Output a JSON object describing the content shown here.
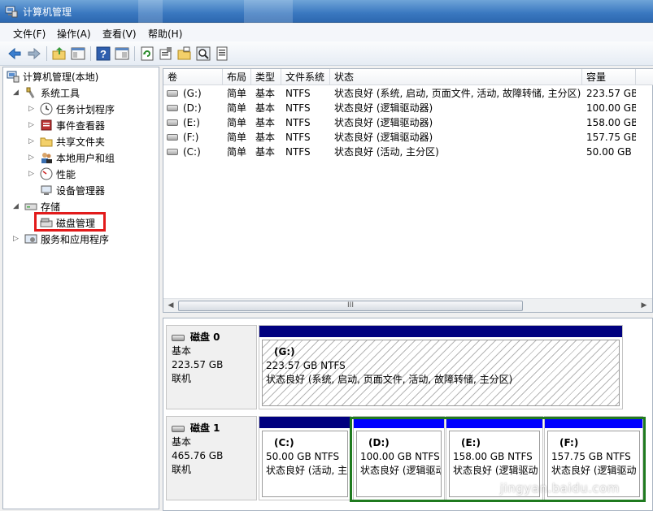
{
  "window": {
    "title": "计算机管理"
  },
  "menu": [
    "文件(F)",
    "操作(A)",
    "查看(V)",
    "帮助(H)"
  ],
  "toolbar": [
    "back-icon",
    "forward-icon",
    "up-folder-icon",
    "show-tree-icon",
    "help-icon",
    "console-icon",
    "refresh-icon",
    "properties-icon",
    "open-folder-icon",
    "search-icon",
    "export-icon"
  ],
  "tree": {
    "root": "计算机管理(本地)",
    "system_tools": "系统工具",
    "items": [
      "任务计划程序",
      "事件查看器",
      "共享文件夹",
      "本地用户和组",
      "性能",
      "设备管理器"
    ],
    "storage": "存储",
    "disk_mgmt": "磁盘管理",
    "services": "服务和应用程序"
  },
  "table": {
    "headers": [
      "卷",
      "布局",
      "类型",
      "文件系统",
      "状态",
      "容量"
    ],
    "rows": [
      {
        "vol": "(G:)",
        "layout": "简单",
        "type": "基本",
        "fs": "NTFS",
        "status": "状态良好 (系统, 启动, 页面文件, 活动, 故障转储, 主分区)",
        "cap": "223.57 GB"
      },
      {
        "vol": "(D:)",
        "layout": "简单",
        "type": "基本",
        "fs": "NTFS",
        "status": "状态良好 (逻辑驱动器)",
        "cap": "100.00 GB"
      },
      {
        "vol": "(E:)",
        "layout": "简单",
        "type": "基本",
        "fs": "NTFS",
        "status": "状态良好 (逻辑驱动器)",
        "cap": "158.00 GB"
      },
      {
        "vol": "(F:)",
        "layout": "简单",
        "type": "基本",
        "fs": "NTFS",
        "status": "状态良好 (逻辑驱动器)",
        "cap": "157.75 GB"
      },
      {
        "vol": "(C:)",
        "layout": "简单",
        "type": "基本",
        "fs": "NTFS",
        "status": "状态良好 (活动, 主分区)",
        "cap": "50.00 GB"
      }
    ],
    "scroll_mark": "III"
  },
  "disks": [
    {
      "name": "磁盘 0",
      "kind": "基本",
      "size": "223.57 GB",
      "state": "联机",
      "parts": [
        {
          "label": "(G:)",
          "size": "223.57 GB NTFS",
          "status": "状态良好 (系统, 启动, 页面文件, 活动, 故障转储, 主分区)"
        }
      ]
    },
    {
      "name": "磁盘 1",
      "kind": "基本",
      "size": "465.76 GB",
      "state": "联机",
      "parts": [
        {
          "label": "(C:)",
          "size": "50.00 GB NTFS",
          "status": "状态良好 (活动, 主"
        },
        {
          "label": "(D:)",
          "size": "100.00 GB NTFS",
          "status": "状态良好 (逻辑驱动"
        },
        {
          "label": "(E:)",
          "size": "158.00 GB NTFS",
          "status": "状态良好 (逻辑驱动"
        },
        {
          "label": "(F:)",
          "size": "157.75 GB NTFS",
          "status": "状态良好 (逻辑驱动"
        }
      ]
    }
  ],
  "watermark": "jingyan.baidu.com",
  "colors": {
    "primary_bar": "#00007f",
    "logical_bar": "#0000ff",
    "highlight_red": "#e21b1b",
    "highlight_green": "#1f7a1f"
  }
}
